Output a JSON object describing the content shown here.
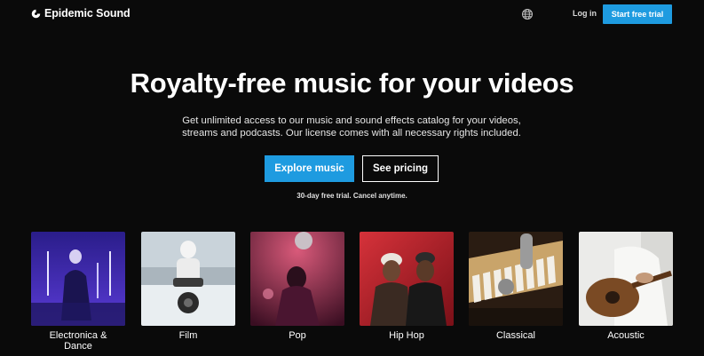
{
  "brand": {
    "name": "Epidemic Sound",
    "logo_icon": "epidemic-sound-logo-icon"
  },
  "header": {
    "globe_icon": "globe-icon",
    "login_label": "Log in",
    "trial_label": "Start free trial",
    "accent_color": "#1e9be0"
  },
  "hero": {
    "title": "Royalty-free music for your videos",
    "subtitle_line1": "Get unlimited access to our music and sound effects catalog for your videos,",
    "subtitle_line2": "streams and podcasts. Our license comes with all necessary rights included.",
    "primary_cta": "Explore music",
    "secondary_cta": "See pricing",
    "fine_print": "30-day free trial. Cancel anytime."
  },
  "genres": [
    {
      "label_line1": "Electronica &",
      "label_line2": "Dance"
    },
    {
      "label_line1": "Film",
      "label_line2": ""
    },
    {
      "label_line1": "Pop",
      "label_line2": ""
    },
    {
      "label_line1": "Hip Hop",
      "label_line2": ""
    },
    {
      "label_line1": "Classical",
      "label_line2": ""
    },
    {
      "label_line1": "Acoustic",
      "label_line2": ""
    }
  ]
}
